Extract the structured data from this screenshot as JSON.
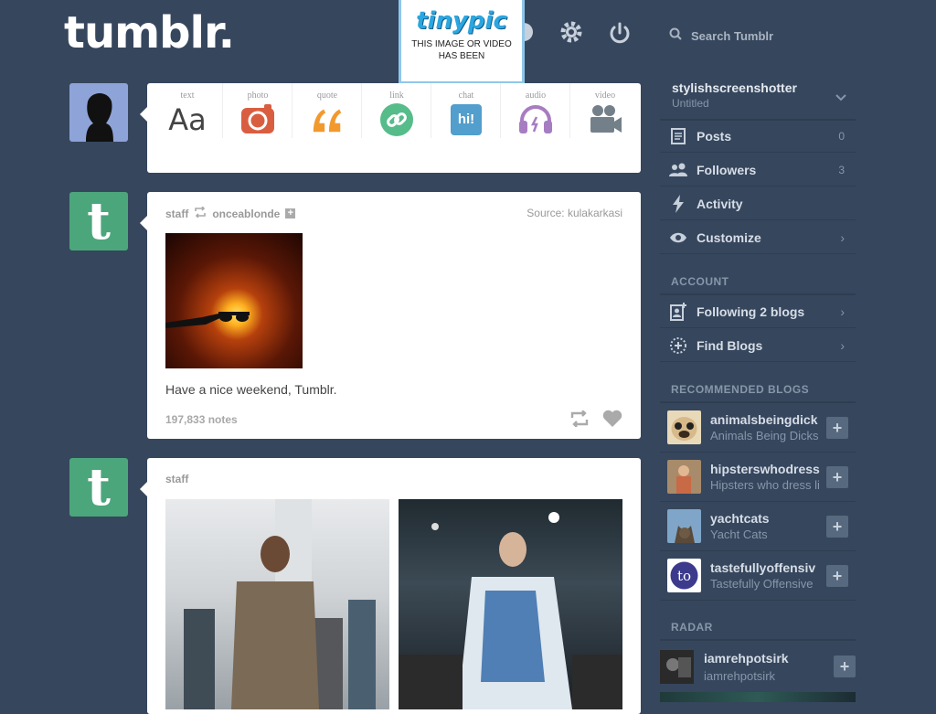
{
  "header": {
    "logo": "tumblr.",
    "search_placeholder": "Search Tumblr"
  },
  "tinypic": {
    "logo": "tinypic",
    "message_line1": "THIS IMAGE OR VIDEO",
    "message_line2": "HAS BEEN"
  },
  "composer": {
    "types": [
      {
        "label": "text",
        "icon": "text-icon",
        "glyph": "Aa",
        "color": "#444444"
      },
      {
        "label": "photo",
        "icon": "camera-icon",
        "color": "#d95e40"
      },
      {
        "label": "quote",
        "icon": "quote-icon",
        "glyph": "❝",
        "color": "#f2992e"
      },
      {
        "label": "link",
        "icon": "link-icon",
        "color": "#56bc8a"
      },
      {
        "label": "chat",
        "icon": "chat-icon",
        "glyph": "hi!",
        "color": "#529ecc"
      },
      {
        "label": "audio",
        "icon": "headphones-icon",
        "color": "#a77dc2"
      },
      {
        "label": "video",
        "icon": "video-camera-icon",
        "color": "#748089"
      }
    ]
  },
  "post1": {
    "author": "staff",
    "reblogged_from": "onceablonde",
    "source_label": "Source:",
    "source": "kulakarkasi",
    "caption": "Have a nice weekend, Tumblr.",
    "notes": "197,833 notes"
  },
  "post2": {
    "author": "staff"
  },
  "sidebar": {
    "blog_name": "stylishscreenshotter",
    "blog_title": "Untitled",
    "items": [
      {
        "label": "Posts",
        "count": "0",
        "icon": "posts-icon"
      },
      {
        "label": "Followers",
        "count": "3",
        "icon": "followers-icon"
      },
      {
        "label": "Activity",
        "icon": "lightning-icon"
      },
      {
        "label": "Customize",
        "icon": "eye-icon"
      }
    ],
    "account_heading": "ACCOUNT",
    "account_items": [
      {
        "label": "Following 2 blogs",
        "icon": "following-icon"
      },
      {
        "label": "Find Blogs",
        "icon": "compass-icon"
      }
    ],
    "recommended_heading": "RECOMMENDED BLOGS",
    "recommended": [
      {
        "name": "animalsbeingdick",
        "title": "Animals Being Dicks"
      },
      {
        "name": "hipsterswhodress",
        "title": "Hipsters who dress li"
      },
      {
        "name": "yachtcats",
        "title": "Yacht Cats"
      },
      {
        "name": "tastefullyoffensiv",
        "title": "Tastefully Offensive"
      }
    ],
    "radar_heading": "RADAR",
    "radar": {
      "name": "iamrehpotsirk",
      "title": "iamrehpotsirk"
    }
  }
}
